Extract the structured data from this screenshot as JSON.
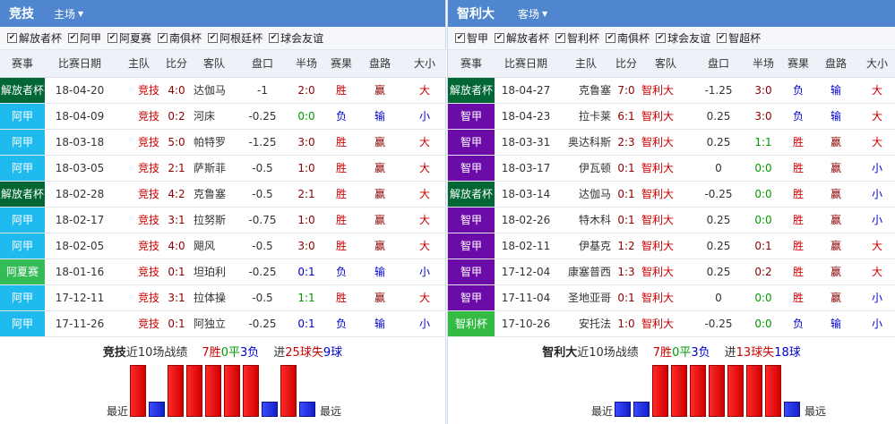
{
  "colors": {
    "header": "#4f86cf",
    "win": "#e00000",
    "loss": "#1b26e0",
    "draw": "#22aa22",
    "league": {
      "解放者杯": "#006633",
      "阿甲": "#1fbbef",
      "阿夏赛": "#33bb55",
      "智甲": "#6b0ca8",
      "智利杯": "#33bb44"
    }
  },
  "columns": [
    "赛事",
    "比赛日期",
    "主队",
    "比分",
    "客队",
    "盘口",
    "半场",
    "赛果",
    "盘路",
    "大小"
  ],
  "left": {
    "team": "竞技",
    "venue": "主场",
    "filters": [
      {
        "label": "解放者杯",
        "checked": true
      },
      {
        "label": "阿甲",
        "checked": true
      },
      {
        "label": "阿夏赛",
        "checked": true
      },
      {
        "label": "南俱杯",
        "checked": true
      },
      {
        "label": "阿根廷杯",
        "checked": true
      },
      {
        "label": "球会友谊",
        "checked": true
      }
    ],
    "rows": [
      {
        "league": "解放者杯",
        "date": "18-04-20",
        "home": "竞技",
        "score": "4:0",
        "away": "达伽马",
        "handicap": "-1",
        "half": "2:0",
        "result": "胜",
        "cover": "赢",
        "ou": "大"
      },
      {
        "league": "阿甲",
        "date": "18-04-09",
        "home": "竞技",
        "score": "0:2",
        "away": "河床",
        "handicap": "-0.25",
        "half": "0:0",
        "result": "负",
        "cover": "输",
        "ou": "小"
      },
      {
        "league": "阿甲",
        "date": "18-03-18",
        "home": "竞技",
        "score": "5:0",
        "away": "帕特罗",
        "handicap": "-1.25",
        "half": "3:0",
        "result": "胜",
        "cover": "赢",
        "ou": "大"
      },
      {
        "league": "阿甲",
        "date": "18-03-05",
        "home": "竞技",
        "score": "2:1",
        "away": "萨斯菲",
        "handicap": "-0.5",
        "half": "1:0",
        "result": "胜",
        "cover": "赢",
        "ou": "大"
      },
      {
        "league": "解放者杯",
        "date": "18-02-28",
        "home": "竞技",
        "score": "4:2",
        "away": "克鲁塞",
        "handicap": "-0.5",
        "half": "2:1",
        "result": "胜",
        "cover": "赢",
        "ou": "大"
      },
      {
        "league": "阿甲",
        "date": "18-02-17",
        "home": "竞技",
        "score": "3:1",
        "away": "拉努斯",
        "handicap": "-0.75",
        "half": "1:0",
        "result": "胜",
        "cover": "赢",
        "ou": "大"
      },
      {
        "league": "阿甲",
        "date": "18-02-05",
        "home": "竞技",
        "score": "4:0",
        "away": "飓风",
        "handicap": "-0.5",
        "half": "3:0",
        "result": "胜",
        "cover": "赢",
        "ou": "大"
      },
      {
        "league": "阿夏赛",
        "date": "18-01-16",
        "home": "竞技",
        "score": "0:1",
        "away": "坦珀利",
        "handicap": "-0.25",
        "half": "0:1",
        "result": "负",
        "cover": "输",
        "ou": "小"
      },
      {
        "league": "阿甲",
        "date": "17-12-11",
        "home": "竞技",
        "score": "3:1",
        "away": "拉体操",
        "handicap": "-0.5",
        "half": "1:1",
        "result": "胜",
        "cover": "赢",
        "ou": "大"
      },
      {
        "league": "阿甲",
        "date": "17-11-26",
        "home": "竞技",
        "score": "0:1",
        "away": "阿独立",
        "handicap": "-0.25",
        "half": "0:1",
        "result": "负",
        "cover": "输",
        "ou": "小"
      }
    ],
    "summary": {
      "team": "竞技",
      "text": "近10场战绩",
      "w": "7胜",
      "d": "0平",
      "l": "3负",
      "gf_label": "进",
      "gf": "25",
      "ga_label": "球失",
      "ga": "9",
      "ga_unit": "球"
    },
    "bar_labels": {
      "recent": "最近",
      "far": "最远"
    }
  },
  "right": {
    "team": "智利大",
    "venue": "客场",
    "filters": [
      {
        "label": "智甲",
        "checked": true
      },
      {
        "label": "解放者杯",
        "checked": true
      },
      {
        "label": "智利杯",
        "checked": true
      },
      {
        "label": "南俱杯",
        "checked": true
      },
      {
        "label": "球会友谊",
        "checked": true
      },
      {
        "label": "智超杯",
        "checked": true
      }
    ],
    "rows": [
      {
        "league": "解放者杯",
        "date": "18-04-27",
        "home": "克鲁塞",
        "score": "7:0",
        "away": "智利大",
        "handicap": "-1.25",
        "half": "3:0",
        "result": "负",
        "cover": "输",
        "ou": "大"
      },
      {
        "league": "智甲",
        "date": "18-04-23",
        "home": "拉卡莱",
        "score": "6:1",
        "away": "智利大",
        "handicap": "0.25",
        "half": "3:0",
        "result": "负",
        "cover": "输",
        "ou": "大"
      },
      {
        "league": "智甲",
        "date": "18-03-31",
        "home": "奥达科斯",
        "score": "2:3",
        "away": "智利大",
        "handicap": "0.25",
        "half": "1:1",
        "result": "胜",
        "cover": "赢",
        "ou": "大"
      },
      {
        "league": "智甲",
        "date": "18-03-17",
        "home": "伊瓦顿",
        "score": "0:1",
        "away": "智利大",
        "handicap": "0",
        "half": "0:0",
        "result": "胜",
        "cover": "赢",
        "ou": "小"
      },
      {
        "league": "解放者杯",
        "date": "18-03-14",
        "home": "达伽马",
        "score": "0:1",
        "away": "智利大",
        "handicap": "-0.25",
        "half": "0:0",
        "result": "胜",
        "cover": "赢",
        "ou": "小"
      },
      {
        "league": "智甲",
        "date": "18-02-26",
        "home": "特木科",
        "score": "0:1",
        "away": "智利大",
        "handicap": "0.25",
        "half": "0:0",
        "result": "胜",
        "cover": "赢",
        "ou": "小"
      },
      {
        "league": "智甲",
        "date": "18-02-11",
        "home": "伊基克",
        "score": "1:2",
        "away": "智利大",
        "handicap": "0.25",
        "half": "0:1",
        "result": "胜",
        "cover": "赢",
        "ou": "大"
      },
      {
        "league": "智甲",
        "date": "17-12-04",
        "home": "康塞普西",
        "score": "1:3",
        "away": "智利大",
        "handicap": "0.25",
        "half": "0:2",
        "result": "胜",
        "cover": "赢",
        "ou": "大"
      },
      {
        "league": "智甲",
        "date": "17-11-04",
        "home": "圣地亚哥",
        "score": "0:1",
        "away": "智利大",
        "handicap": "0",
        "half": "0:0",
        "result": "胜",
        "cover": "赢",
        "ou": "小"
      },
      {
        "league": "智利杯",
        "date": "17-10-26",
        "home": "安托法",
        "score": "1:0",
        "away": "智利大",
        "handicap": "-0.25",
        "half": "0:0",
        "result": "负",
        "cover": "输",
        "ou": "小"
      }
    ],
    "summary": {
      "team": "智利大",
      "text": "近10场战绩",
      "w": "7胜",
      "d": "0平",
      "l": "3负",
      "gf_label": "进",
      "gf": "13",
      "ga_label": "球失",
      "ga": "18",
      "ga_unit": "球"
    },
    "bar_labels": {
      "recent": "最近",
      "far": "最远"
    }
  }
}
